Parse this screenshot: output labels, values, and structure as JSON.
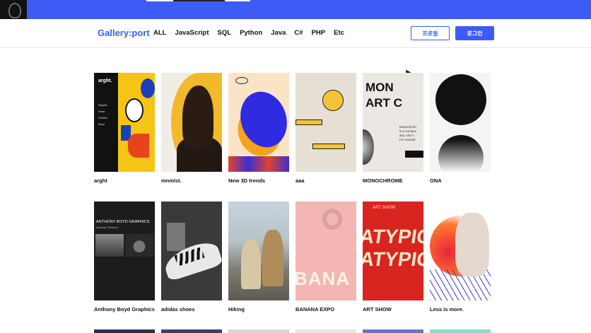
{
  "header": {
    "logo": "Gallery:port",
    "nav": [
      "ALL",
      "JavaScript",
      "SQL",
      "Python",
      "Java",
      "C#",
      "PHP",
      "Etc"
    ],
    "profile_button": "프로필",
    "login_button": "로그인"
  },
  "gallery": {
    "items": [
      {
        "title": "arght",
        "thumb_text": "arght.",
        "menu": "Register\nHome\nPortfolio\nAbout"
      },
      {
        "title": "mnmlst."
      },
      {
        "title": "New 3D trends",
        "thumb_text": "The new"
      },
      {
        "title": "aaa"
      },
      {
        "title": "MONOCHROME",
        "thumb_text": "MON\nART C",
        "thumb_sub": "Monochrom\nis a compos\nany color t\nFor exampl"
      },
      {
        "title": "ONA"
      },
      {
        "title": "Anthony Boyd Graphics",
        "thumb_text": "ANTHONY BOYD GRAPHICS",
        "thumb_sub": "Mockups Textures"
      },
      {
        "title": "adidas shoes"
      },
      {
        "title": "Hiking"
      },
      {
        "title": "BANANA EXPO",
        "thumb_text": "BANA"
      },
      {
        "title": "ART SHOW",
        "thumb_text": "ATYPICA",
        "thumb_sub": "ART SHOW"
      },
      {
        "title": "Less is more."
      }
    ]
  },
  "colors": {
    "accent": "#3d5cf5",
    "text": "#111111"
  }
}
